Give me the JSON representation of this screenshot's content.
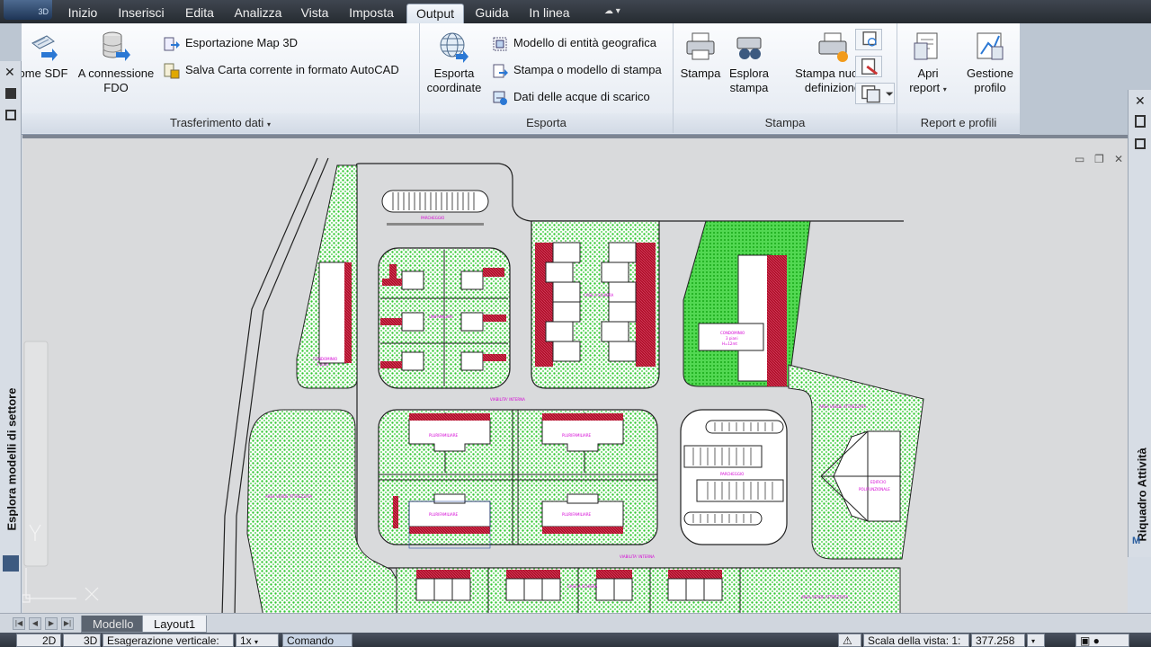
{
  "app": {
    "logo_text": "3D",
    "cloud_label": "☁ ▾"
  },
  "menu": {
    "tabs": [
      "Inizio",
      "Inserisci",
      "Edita",
      "Analizza",
      "Vista",
      "Imposta",
      "Output",
      "Guida",
      "In linea"
    ],
    "active": "Output"
  },
  "ribbon": {
    "transfer": {
      "title": "Trasferimento dati",
      "title_arrow": "▾",
      "sdf_label": "ome SDF",
      "fdo_label_1": "A connessione",
      "fdo_label_2": "FDO",
      "export_map3d": "Esportazione Map 3D",
      "save_map": "Salva Carta corrente in formato AutoCAD"
    },
    "export": {
      "title": "Esporta",
      "coords_label_1": "Esporta",
      "coords_label_2": "coordinate",
      "entity_model": "Modello di entità geografica",
      "print_model": "Stampa o modello di stampa",
      "drain_data": "Dati delle acque di scarico"
    },
    "print": {
      "title": "Stampa",
      "print_label": "Stampa",
      "explore_label_1": "Esplora",
      "explore_label_2": "stampa",
      "new_def_label_1": "Stampa nuova",
      "new_def_label_2": "definizione"
    },
    "reports": {
      "title": "Report e profili",
      "open_label_1": "Apri",
      "open_label_2": "report",
      "profile_label_1": "Gestione",
      "profile_label_2": "profilo"
    }
  },
  "palettes": {
    "left_title": "Esplora modelli di settore",
    "right_title": "Riquadro Attività",
    "close_glyph": "✕"
  },
  "drawing": {
    "labels": {
      "parcheggio_top": "PARCHEGGIO",
      "parcheggio_mid": "PARCHEGGIO",
      "unifamiliari": "UNIFAMILIARI",
      "case_schiera": "CASE A SCHIERA",
      "condominio_left_1": "CONDOMINIO",
      "condominio_left_2": "3 piani",
      "condominio_right_1": "CONDOMINIO",
      "condominio_right_2": "3 piani",
      "condominio_right_3": "H=12mt",
      "viabilita_1": "VIABILITA' INTERNA",
      "viabilita_2": "VIABILITA' INTERNA",
      "plurifam": "PLURIFAMILIARE",
      "area_verde_left": "AREA VERDE ATTREZZATA",
      "area_verde_right": "AREA VERDE ATTREZZATA",
      "area_verde_bottom": "AREA VERDE ATTREZZATA",
      "edificio_1": "EDIFICIO",
      "edificio_2": "POLIFUNZIONALE",
      "case_schiera_bottom": "CASE A SCHIERA"
    }
  },
  "layout_tabs": {
    "model": "Modello",
    "layout1": "Layout1"
  },
  "status": {
    "mode_2d": "2D",
    "mode_3d": "3D",
    "vertical_exag_label": "Esagerazione verticale:",
    "vertical_exag_value": "1x",
    "command": "Comando",
    "view_scale": "Scala della vista: 1:",
    "view_scale_value": "377.258"
  },
  "colors": {
    "accent_red": "#b0102a",
    "green_area": "#32c832",
    "label_magenta": "#d400d4"
  }
}
